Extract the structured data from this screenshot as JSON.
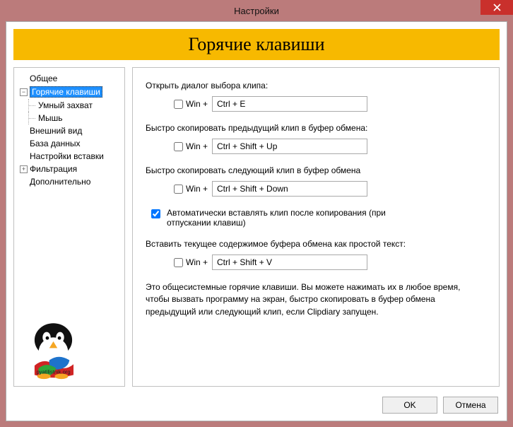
{
  "window": {
    "title": "Настройки"
  },
  "banner": {
    "title": "Горячие клавиши"
  },
  "sidebar": {
    "items": [
      {
        "label": "Общее",
        "toggle": ""
      },
      {
        "label": "Горячие клавиши",
        "toggle": "−",
        "selected": true
      },
      {
        "label": "Умный захват",
        "child": true
      },
      {
        "label": "Мышь",
        "child": true
      },
      {
        "label": "Внешний вид",
        "toggle": ""
      },
      {
        "label": "База данных",
        "toggle": ""
      },
      {
        "label": "Настройки вставки",
        "toggle": ""
      },
      {
        "label": "Фильтрация",
        "toggle": "+"
      },
      {
        "label": "Дополнительно",
        "toggle": ""
      }
    ]
  },
  "hotkeys": {
    "win_label": "Win +",
    "open_dialog": {
      "label": "Открыть диалог выбора клипа:",
      "value": "Ctrl + E",
      "win": false
    },
    "copy_prev": {
      "label": "Быстро скопировать предыдущий клип в буфер обмена:",
      "value": "Ctrl + Shift + Up",
      "win": false
    },
    "copy_next": {
      "label": "Быстро скопировать следующий клип в буфер обмена",
      "value": "Ctrl + Shift + Down",
      "win": false
    },
    "auto_paste": {
      "label": "Автоматически вставлять клип после копирования (при отпускании клавиш)",
      "checked": true
    },
    "paste_plain": {
      "label": "Вставить текущее содержимое буфера обмена как простой текст:",
      "value": "Ctrl + Shift + V",
      "win": false
    },
    "hint": "Это общесистемные горячие клавиши. Вы можете нажимать их в любое время, чтобы вызвать программу на экран, быстро скопировать в буфер обмена предыдущий или следующий клип, если Clipdiary запущен."
  },
  "buttons": {
    "ok": "OK",
    "cancel": "Отмена"
  },
  "logo": {
    "watermark": "pyatilistnik.org"
  }
}
